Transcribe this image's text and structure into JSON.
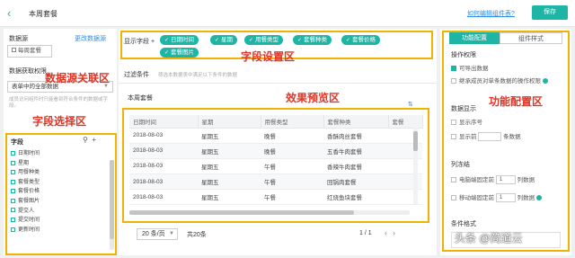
{
  "header": {
    "back_icon": "back-icon",
    "title": "本周套餐",
    "help_link": "如何编辑组件表?",
    "save_label": "保存"
  },
  "left": {
    "datasource_label": "数据源",
    "change_link": "更改数据源",
    "datasource_item": "每周套餐",
    "perm_label": "数据获取权限",
    "perm_value": "表单中的全部数据",
    "perm_note": "成员访问组件时只能看到符合条件的数据或字段。",
    "field_header": "字段",
    "fields": [
      "日期时间",
      "星期",
      "用餐种类",
      "套餐类型",
      "套餐价格",
      "套餐图片",
      "提交人",
      "提交时间",
      "更新时间"
    ]
  },
  "center": {
    "display_label": "显示字段",
    "chips": [
      "日期时间",
      "星期",
      "用餐类型",
      "套餐种类",
      "套餐价格",
      "套餐图片"
    ],
    "filter_label": "过滤条件",
    "filter_hint": "筛选本数据表中满足以下条件的数据",
    "table_title": "本周套餐",
    "columns": [
      "日期时间",
      "星期",
      "用餐类型",
      "套餐种类",
      "套餐"
    ],
    "rows": [
      [
        "2018-08-03",
        "星期五",
        "晚餐",
        "香酥肉丝套餐",
        ""
      ],
      [
        "2018-08-03",
        "星期五",
        "晚餐",
        "五香牛肉套餐",
        ""
      ],
      [
        "2018-08-03",
        "星期五",
        "午餐",
        "香辣牛肉套餐",
        ""
      ],
      [
        "2018-08-03",
        "星期五",
        "午餐",
        "回锅肉套餐",
        ""
      ],
      [
        "2018-08-03",
        "星期五",
        "午餐",
        "红烧鱼块套餐",
        ""
      ]
    ],
    "page_size": "20 条/页",
    "total": "共20条",
    "page": "1 / 1"
  },
  "right": {
    "tab_active": "功能配置",
    "tab_inactive": "组件样式",
    "ops_title": "操作权限",
    "opt_export": "可导出数据",
    "opt_inherit": "继承成员对单条数据的操作权限",
    "display_title": "数据显示",
    "opt_serial": "显示序号",
    "opt_show_before": "显示前",
    "opt_show_after": "条数据",
    "freeze_title": "列冻结",
    "opt_pc": "电脑端固定前",
    "opt_mobile": "移动端固定前",
    "freeze_value": "1",
    "freeze_unit": "列数据",
    "cond_title": "条件格式"
  },
  "annotations": {
    "datasource": "数据源关联区",
    "field_select": "字段选择区",
    "field_setting": "字段设置区",
    "preview": "效果预览区",
    "config": "功能配置区"
  },
  "watermark": "头条 @简道云",
  "colors": {
    "accent": "#1fb5a6",
    "highlight": "#f0b400",
    "annotation": "#e53222",
    "link": "#2b8fe8"
  }
}
